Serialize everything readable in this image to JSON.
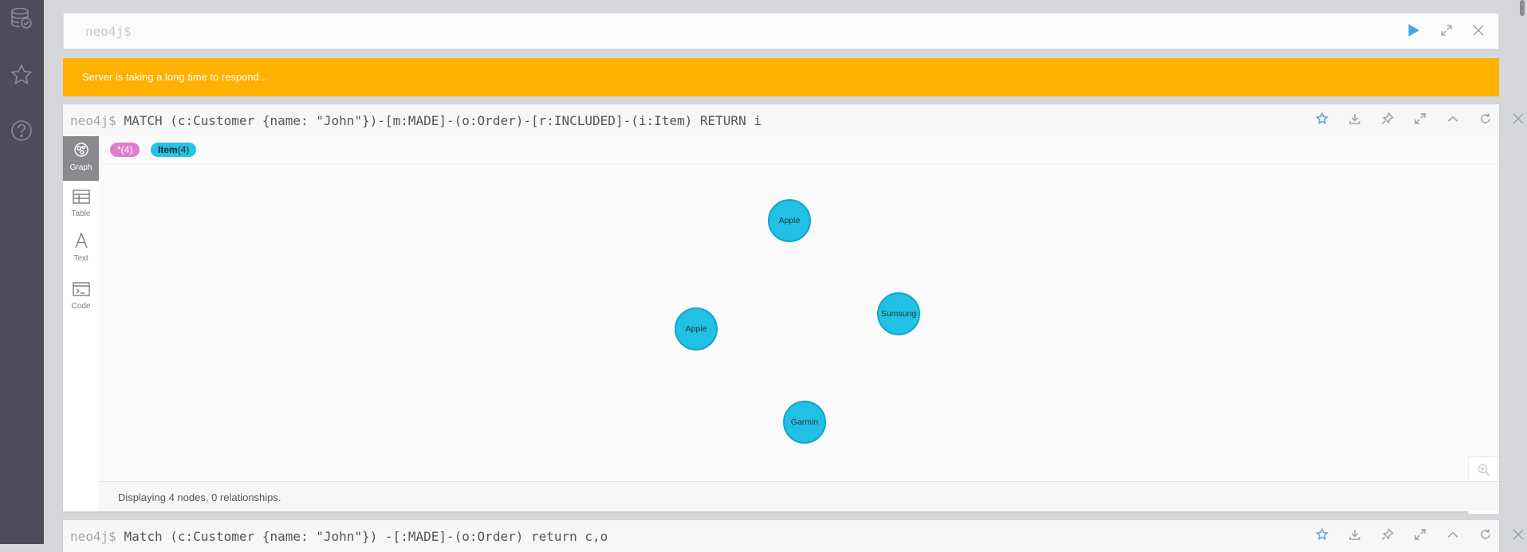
{
  "rail": {
    "items": [
      {
        "icon": "database-icon"
      },
      {
        "icon": "star-icon"
      },
      {
        "icon": "help-icon"
      }
    ]
  },
  "editor": {
    "placeholder": "neo4j$",
    "icons": [
      "play-icon",
      "expand-icon",
      "close-icon"
    ],
    "accent": "#4aa6dc"
  },
  "banner": {
    "text": "Server is taking a long time to respond...",
    "color": "#ffb100"
  },
  "frames": [
    {
      "prompt": "neo4j$",
      "query": "MATCH (c:Customer {name: \"John\"})-[m:MADE]-(o:Order)-[r:INCLUDED]-(i:Item) RETURN i",
      "tabs": [
        {
          "label": "Graph",
          "icon": "graph-icon",
          "active": true
        },
        {
          "label": "Table",
          "icon": "table-icon"
        },
        {
          "label": "Text",
          "icon": "text-icon"
        },
        {
          "label": "Code",
          "icon": "code-icon"
        }
      ],
      "legend": {
        "all_label": "*(4)",
        "item_name": "Item",
        "item_count": "(4)"
      },
      "nodes": [
        {
          "label": "Apple"
        },
        {
          "label": "Sumsung"
        },
        {
          "label": "Apple"
        },
        {
          "label": "Garmin"
        }
      ],
      "status": "Displaying 4 nodes, 0 relationships."
    },
    {
      "prompt": "neo4j$",
      "query": "Match (c:Customer {name: \"John\"}) -[:MADE]-(o:Order) return c,o"
    }
  ],
  "colors": {
    "node_fill": "#21c1e6",
    "legend_all": "#da7fcf",
    "rail_bg": "#4f4b5c"
  }
}
